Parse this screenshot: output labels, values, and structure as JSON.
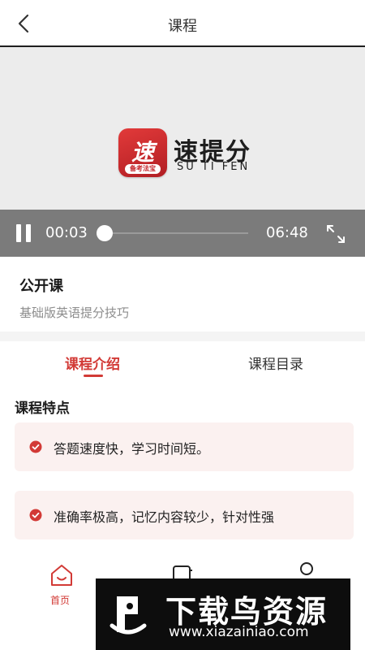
{
  "header": {
    "title": "课程"
  },
  "video": {
    "brand_cn": "速提分",
    "brand_en": "SU TI FEN",
    "icon_glyph": "速",
    "icon_tag": "备考法宝",
    "current_time": "00:03",
    "total_time": "06:48",
    "progress": 0.0074
  },
  "course": {
    "title": "公开课",
    "subtitle": "基础版英语提分技巧"
  },
  "tabs": [
    {
      "label": "课程介绍",
      "active": true
    },
    {
      "label": "课程目录",
      "active": false
    }
  ],
  "features": {
    "title": "课程特点",
    "items": [
      "答题速度快，学习时间短。",
      "准确率极高，记忆内容较少，针对性强"
    ]
  },
  "nav": {
    "home_label": "首页"
  },
  "watermark": {
    "title": "下载鸟资源",
    "url": "www.xiazainiao.com"
  },
  "colors": {
    "accent": "#d23a36",
    "control_bar": "#7b7b7b",
    "feature_bg": "#fbf1f0"
  },
  "icons": {
    "back": "chevron-left-icon",
    "pause": "pause-icon",
    "fullscreen": "expand-icon",
    "check": "check-circle-icon",
    "home": "home-icon",
    "book": "book-icon",
    "user": "user-icon"
  }
}
